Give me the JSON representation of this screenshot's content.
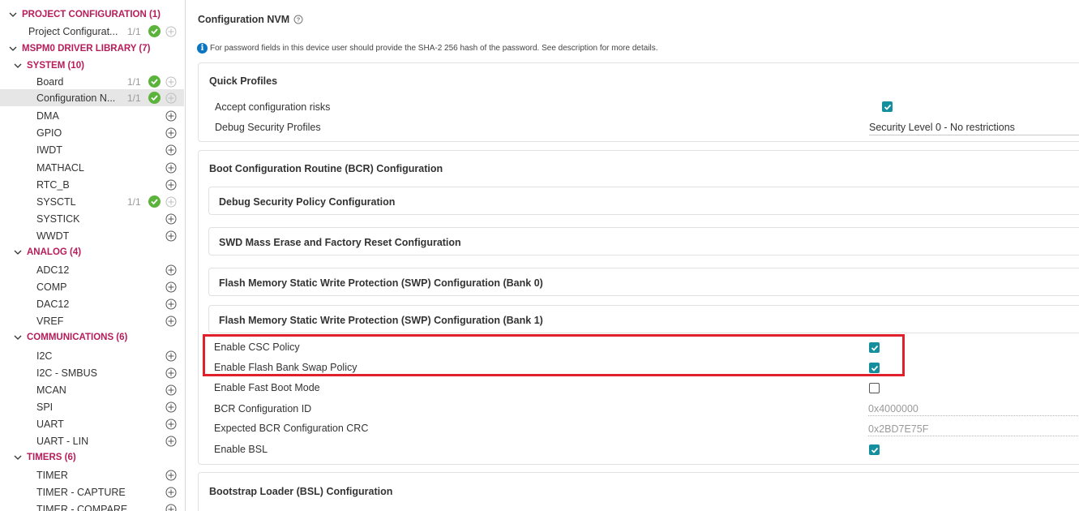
{
  "sidebar": {
    "project_configuration": {
      "label": "PROJECT CONFIGURATION (1)",
      "items": [
        {
          "label": "Project Configurat...",
          "count": "1/1"
        }
      ]
    },
    "driver_library": {
      "label": "MSPM0 DRIVER LIBRARY (7)"
    },
    "system": {
      "label": "SYSTEM (10)",
      "items": [
        {
          "label": "Board",
          "count": "1/1"
        },
        {
          "label": "Configuration N...",
          "count": "1/1"
        },
        {
          "label": "DMA"
        },
        {
          "label": "GPIO"
        },
        {
          "label": "IWDT"
        },
        {
          "label": "MATHACL"
        },
        {
          "label": "RTC_B"
        },
        {
          "label": "SYSCTL",
          "count": "1/1"
        },
        {
          "label": "SYSTICK"
        },
        {
          "label": "WWDT"
        }
      ]
    },
    "analog": {
      "label": "ANALOG (4)",
      "items": [
        {
          "label": "ADC12"
        },
        {
          "label": "COMP"
        },
        {
          "label": "DAC12"
        },
        {
          "label": "VREF"
        }
      ]
    },
    "communications": {
      "label": "COMMUNICATIONS (6)",
      "items": [
        {
          "label": "I2C"
        },
        {
          "label": "I2C - SMBUS"
        },
        {
          "label": "MCAN"
        },
        {
          "label": "SPI"
        },
        {
          "label": "UART"
        },
        {
          "label": "UART - LIN"
        }
      ]
    },
    "timers": {
      "label": "TIMERS (6)",
      "items": [
        {
          "label": "TIMER"
        },
        {
          "label": "TIMER - CAPTURE"
        },
        {
          "label": "TIMER - COMPARE"
        }
      ]
    }
  },
  "main": {
    "title": "Configuration NVM",
    "info": "For password fields in this device user should provide the SHA-2 256 hash of the password. See description for more details.",
    "quick_profiles": {
      "title": "Quick Profiles",
      "accept_risks_label": "Accept configuration risks",
      "accept_risks_checked": true,
      "debug_profiles_label": "Debug Security Profiles",
      "debug_profiles_value": "Security Level 0 - No restrictions"
    },
    "bcr": {
      "title": "Boot Configuration Routine (BCR) Configuration",
      "sections": [
        "Debug Security Policy Configuration",
        "SWD Mass Erase and Factory Reset Configuration",
        "Flash Memory Static Write Protection (SWP) Configuration (Bank 0)",
        "Flash Memory Static Write Protection (SWP) Configuration (Bank 1)"
      ],
      "fields": {
        "csc_label": "Enable CSC Policy",
        "csc_checked": true,
        "bank_swap_label": "Enable Flash Bank Swap Policy",
        "bank_swap_checked": true,
        "fast_boot_label": "Enable Fast Boot Mode",
        "fast_boot_checked": false,
        "config_id_label": "BCR Configuration ID",
        "config_id_value": "0x4000000",
        "crc_label": "Expected BCR Configuration CRC",
        "crc_value": "0x2BD7E75F",
        "bsl_label": "Enable BSL",
        "bsl_checked": true
      }
    },
    "bsl": {
      "title": "Bootstrap Loader (BSL) Configuration"
    }
  },
  "colors": {
    "category": "#b71c5a",
    "check_ok": "#5bb33b",
    "checkbox": "#148f9e",
    "highlight": "#e0202b",
    "info": "#0b75c2"
  }
}
